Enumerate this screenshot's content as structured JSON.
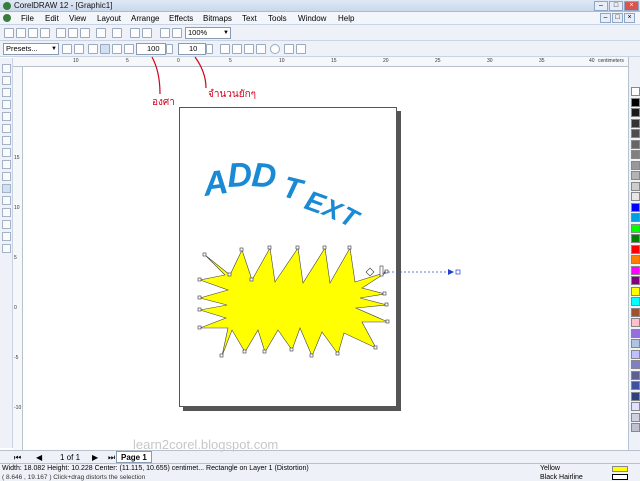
{
  "window": {
    "title": "CorelDRAW 12 - [Graphic1]"
  },
  "menu": [
    "File",
    "Edit",
    "View",
    "Layout",
    "Arrange",
    "Effects",
    "Bitmaps",
    "Text",
    "Tools",
    "Window",
    "Help"
  ],
  "toolbar": {
    "zoom": "100%",
    "presets": "Presets...",
    "amplitude": "100",
    "frequency": "10"
  },
  "rulers": {
    "top_ticks": [
      "10",
      "5",
      "0",
      "5",
      "10",
      "15",
      "20",
      "25",
      "30",
      "35",
      "40"
    ],
    "unit": "centimeters",
    "left_ticks": [
      "15",
      "10",
      "5",
      "0",
      "-5",
      "-10"
    ]
  },
  "annotations": {
    "degree_label": "องศา",
    "frequency_label": "จำนวนยักๆ"
  },
  "artwork": {
    "text": "ADD TEXT",
    "text_color": "#1a8ad4",
    "star_fill": "#ffff00"
  },
  "page_nav": {
    "counter": "1 of 1",
    "tab": "Page 1"
  },
  "watermark": "learn2corel.blogspot.com",
  "status": {
    "line1": "Width: 18.082  Height: 10.228  Center: (11.115, 10.655)  centimet...   Rectangle on Layer 1  (Distortion)",
    "line2": "( 8.646 , 19.167 )     Click+drag distorts the selection",
    "fill": "Yellow",
    "outline": "Black  Hairline"
  },
  "palette": [
    "#ffffff",
    "#000000",
    "#1a1a1a",
    "#333333",
    "#4d4d4d",
    "#666666",
    "#808080",
    "#999999",
    "#b3b3b3",
    "#cccccc",
    "#e6e6e6",
    "#0000ff",
    "#00a0e0",
    "#00ff00",
    "#008000",
    "#ff0000",
    "#ff8000",
    "#ff00ff",
    "#800080",
    "#ffff00",
    "#00ffff",
    "#a0522d",
    "#ffc0cb",
    "#9370db",
    "#b0c4de",
    "#c0c0ff",
    "#8080c0",
    "#606090",
    "#4050a0",
    "#304080",
    "#e0e0ff",
    "#d0d0e0",
    "#c0c0d0"
  ]
}
